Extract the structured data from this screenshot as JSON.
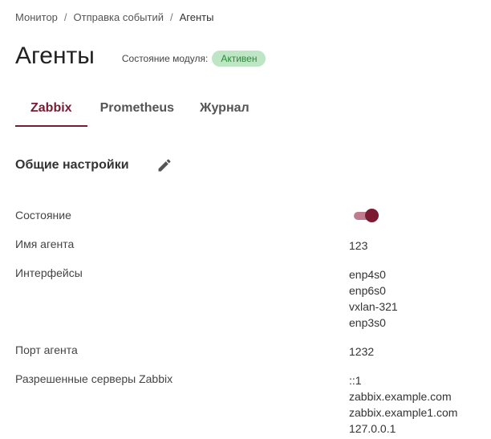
{
  "breadcrumb": {
    "items": [
      "Монитор",
      "Отправка событий"
    ],
    "current": "Агенты",
    "separator": "/"
  },
  "page": {
    "title": "Агенты",
    "module_state_label": "Состояние модуля:",
    "module_state_value": "Активен"
  },
  "tabs": [
    {
      "label": "Zabbix",
      "active": true
    },
    {
      "label": "Prometheus",
      "active": false
    },
    {
      "label": "Журнал",
      "active": false
    }
  ],
  "section": {
    "title": "Общие настройки",
    "edit_icon": "pencil-icon"
  },
  "settings": {
    "state": {
      "label": "Состояние",
      "enabled": true
    },
    "agent_name": {
      "label": "Имя агента",
      "value": "123"
    },
    "interfaces": {
      "label": "Интерфейсы",
      "values": [
        "enp4s0",
        "enp6s0",
        "vxlan-321",
        "enp3s0"
      ]
    },
    "agent_port": {
      "label": "Порт агента",
      "value": "1232"
    },
    "allowed_servers": {
      "label": "Разрешенные серверы Zabbix",
      "values": [
        "::1",
        "zabbix.example.com",
        "zabbix.example1.com",
        "127.0.0.1"
      ]
    }
  },
  "colors": {
    "accent": "#7a1a33",
    "badge_bg": "#bfe6c4",
    "badge_text": "#2a8a3c"
  }
}
